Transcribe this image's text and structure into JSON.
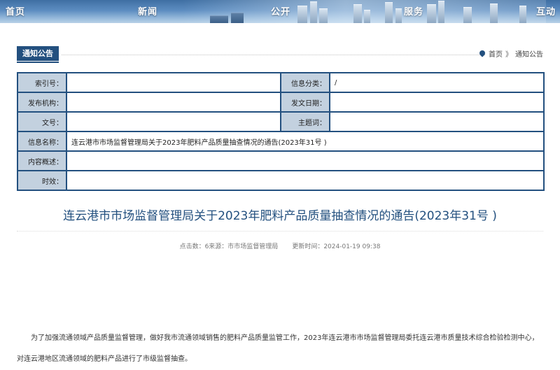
{
  "nav": [
    "首页",
    "新闻",
    "公开",
    "服务",
    "互动"
  ],
  "section_title": "通知公告",
  "breadcrumb": {
    "home": "首页",
    "separator": "》",
    "current": "通知公告"
  },
  "info_table": {
    "index_no": {
      "label": "索引号：",
      "value": ""
    },
    "info_category": {
      "label": "信息分类：",
      "value": "/"
    },
    "publisher": {
      "label": "发布机构：",
      "value": ""
    },
    "issue_date": {
      "label": "发文日期：",
      "value": ""
    },
    "doc_no": {
      "label": "文号：",
      "value": ""
    },
    "subject_terms": {
      "label": "主题词：",
      "value": ""
    },
    "info_name": {
      "label": "信息名称：",
      "value": "连云港市市场监督管理局关于2023年肥料产品质量抽查情况的通告(2023年31号 )"
    },
    "content_summary": {
      "label": "内容概述：",
      "value": ""
    },
    "validity": {
      "label": "时效：",
      "value": ""
    }
  },
  "article": {
    "title": "连云港市市场监督管理局关于2023年肥料产品质量抽查情况的通告(2023年31号 )",
    "clicks": "点击数：6",
    "source": "来源：市市场监督管理局",
    "updated": "更新时间：2024-01-19 09:38",
    "paragraph": "为了加强流通领域产品质量监督管理，做好我市流通领域销售的肥料产品质量监管工作，2023年连云港市市场监督管理局委托连云港市质量技术综合检验检测中心，对连云港地区流通领域的肥料产品进行了市级监督抽查。"
  },
  "colors": {
    "accent": "#23507f",
    "label_bg": "#c3d1df",
    "title_text": "#23507f"
  }
}
